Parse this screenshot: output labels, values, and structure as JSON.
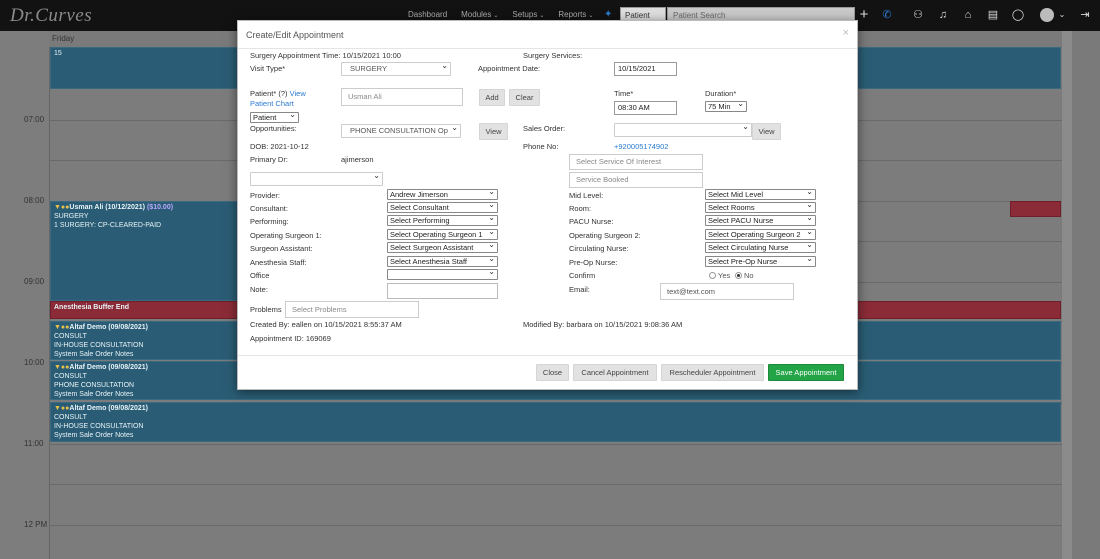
{
  "nav": {
    "brand": "Dr.Curves",
    "menu": [
      "Dashboard",
      "Modules",
      "Setups",
      "Reports"
    ],
    "patient_select": "Patient",
    "search_placeholder": "Patient Search"
  },
  "calendar": {
    "day": "Friday",
    "date": "15",
    "times": [
      "07:00",
      "08:00",
      "09:00",
      "10:00",
      "11:00",
      "12 PM"
    ],
    "events": [
      {
        "title": "Usman Ali (10/12/2021)",
        "amount": "($10.00)",
        "lines": [
          "SURGERY",
          "1 SURGERY: CP-CLEARED-PAID"
        ]
      },
      {
        "title": "Anesthesia Buffer End",
        "lines": []
      },
      {
        "title": "Altaf Demo (09/08/2021)",
        "lines": [
          "CONSULT",
          "IN-HOUSE CONSULTATION",
          "System Sale Order Notes"
        ]
      },
      {
        "title": "Altaf Demo (09/08/2021)",
        "lines": [
          "CONSULT",
          "PHONE CONSULTATION",
          "System Sale Order Notes"
        ]
      },
      {
        "title": "Altaf Demo (09/08/2021)",
        "lines": [
          "CONSULT",
          "IN-HOUSE CONSULTATION",
          "System Sale Order Notes"
        ]
      }
    ]
  },
  "modal": {
    "title": "Create/Edit Appointment",
    "close": "×",
    "surgery_time_label": "Surgery Appointment Time: 10/15/2021 10:00",
    "surgery_services_label": "Surgery Services:",
    "visit_type_label": "Visit Type*",
    "visit_type_value": "SURGERY",
    "appointment_date_label": "Appointment Date:",
    "appointment_date_value": "10/15/2021",
    "patient_label": "Patient* (?)",
    "view_patient_chart": "View Patient Chart",
    "patient_value": "Usman Ali",
    "add_label": "Add",
    "clear_label": "Clear",
    "time_label": "Time*",
    "time_value": "08:30 AM",
    "duration_label": "Duration*",
    "duration_value": "75 Min",
    "patient_type": "Patient",
    "opportunities_label": "Opportunities:",
    "opportunities_value": "PHONE CONSULTATION Op",
    "view_label": "View",
    "sales_order_label": "Sales Order:",
    "sales_order_value": "",
    "dob_label": "DOB: 2021-10-12",
    "phone_label": "Phone No:",
    "phone_value": "+920005174902",
    "primary_dr_label": "Primary Dr:",
    "primary_dr_value": "ajimerson",
    "service_interest_placeholder": "Select Service Of Interest",
    "service_booked_placeholder": "Service Booked",
    "left_fields": [
      {
        "label": "Provider:",
        "value": "Andrew Jimerson"
      },
      {
        "label": "Consultant:",
        "value": "Select Consultant"
      },
      {
        "label": "Performing:",
        "value": "Select Performing"
      },
      {
        "label": "Operating Surgeon 1:",
        "value": "Select Operating Surgeon 1"
      },
      {
        "label": "Surgeon Assistant:",
        "value": "Select Surgeon Assistant"
      },
      {
        "label": "Anesthesia Staff:",
        "value": "Select Anesthesia Staff"
      },
      {
        "label": "Office",
        "value": ""
      }
    ],
    "right_fields": [
      {
        "label": "Mid Level:",
        "value": "Select Mid Level"
      },
      {
        "label": "Room:",
        "value": "Select Rooms"
      },
      {
        "label": "PACU Nurse:",
        "value": "Select PACU Nurse"
      },
      {
        "label": "Operating Surgeon 2:",
        "value": "Select Operating Surgeon 2"
      },
      {
        "label": "Circulating Nurse:",
        "value": "Select Circulating Nurse"
      },
      {
        "label": "Pre-Op Nurse:",
        "value": "Select Pre-Op Nurse"
      }
    ],
    "confirm_label": "Confirm",
    "confirm_yes": "Yes",
    "confirm_no": "No",
    "note_label": "Note:",
    "email_label": "Email:",
    "email_value": "text@text.com",
    "problems_label": "Problems",
    "problems_placeholder": "Select Problems",
    "created_by": "Created By: eallen on 10/15/2021 8:55:37 AM",
    "modified_by": "Modified By: barbara on 10/15/2021 9:08:36 AM",
    "appointment_id": "Appointment ID: 169069",
    "buttons": {
      "close": "Close",
      "cancel": "Cancel Appointment",
      "reschedule": "Rescheduler Appointment",
      "save": "Save Appointment"
    }
  }
}
